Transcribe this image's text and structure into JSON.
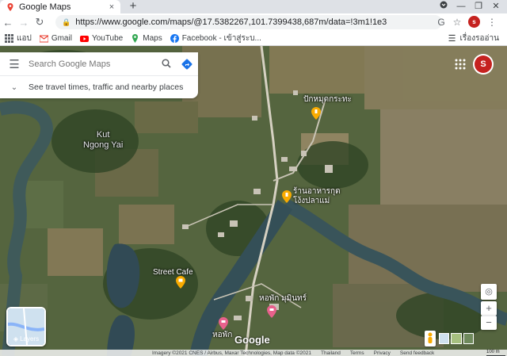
{
  "browser": {
    "tab_title": "Google Maps",
    "tab_close": "×",
    "new_tab": "+",
    "tab_search": "⌄",
    "url": "https://www.google.com/maps/@17.5382267,101.7399438,687m/data=!3m1!1e3",
    "profile_initial": "s"
  },
  "bookmarks": {
    "items": [
      {
        "label": "แอป",
        "icon": "apps-grid-icon"
      },
      {
        "label": "Gmail",
        "icon": "gmail-icon"
      },
      {
        "label": "YouTube",
        "icon": "youtube-icon"
      },
      {
        "label": "Maps",
        "icon": "maps-pin-icon"
      },
      {
        "label": "Facebook - เข้าสู่ระบ...",
        "icon": "facebook-icon"
      }
    ],
    "reading_list": "เรื่องรออ่าน"
  },
  "maps": {
    "search_placeholder": "Search Google Maps",
    "travel_prompt": "See travel times, traffic and nearby places",
    "profile_initial": "S",
    "layers_label": "Layers",
    "google_logo": "Google",
    "places": [
      {
        "name": "ปักหมุดกระทะ"
      },
      {
        "name": "ร้านอาหารกุด\nโง้งปลาแม่"
      },
      {
        "name": "Street Cafe"
      },
      {
        "name": "หอพัก มุมินทร์"
      },
      {
        "name": "หอพัก"
      }
    ],
    "area_label": "Kut\nNgong Yai",
    "footer": {
      "imagery": "Imagery ©2021 CNES / Airbus, Maxar Technologies, Map data ©2021",
      "country": "Thailand",
      "terms": "Terms",
      "privacy": "Privacy",
      "feedback": "Send feedback",
      "scale": "100 m"
    },
    "zoom_in": "+",
    "zoom_out": "−",
    "colors": {
      "pin": "#f9ab00",
      "hotel_pin": "#e8618c",
      "profile": "#c5221f"
    }
  }
}
